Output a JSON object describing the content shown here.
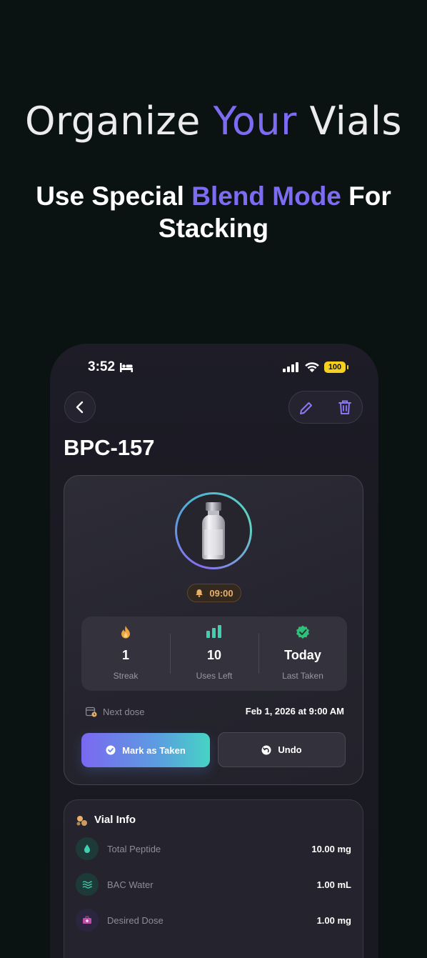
{
  "hero": {
    "title_pre": "Organize ",
    "title_accent": "Your",
    "title_post": " Vials",
    "sub_pre": "Use Special ",
    "sub_accent": "Blend Mode",
    "sub_post": " For Stacking"
  },
  "status_bar": {
    "time": "3:52",
    "battery": "100"
  },
  "vial": {
    "name": "BPC-157",
    "reminder_time": "09:00"
  },
  "stats": [
    {
      "value": "1",
      "label": "Streak",
      "icon": "flame-icon"
    },
    {
      "value": "10",
      "label": "Uses Left",
      "icon": "bar-chart-icon"
    },
    {
      "value": "Today",
      "label": "Last Taken",
      "icon": "verified-check-icon"
    }
  ],
  "next_dose": {
    "label": "Next dose",
    "value": "Feb 1, 2026 at 9:00 AM"
  },
  "buttons": {
    "mark_taken": "Mark as Taken",
    "undo": "Undo"
  },
  "vial_info": {
    "title": "Vial Info",
    "rows": [
      {
        "label": "Total Peptide",
        "value": "10.00 mg",
        "icon": "droplet-icon"
      },
      {
        "label": "BAC Water",
        "value": "1.00 mL",
        "icon": "waves-icon"
      },
      {
        "label": "Desired Dose",
        "value": "1.00 mg",
        "icon": "medkit-icon"
      }
    ]
  },
  "colors": {
    "accent": "#7c6cf2",
    "teal": "#46d4c4",
    "background": "#0b1312"
  }
}
